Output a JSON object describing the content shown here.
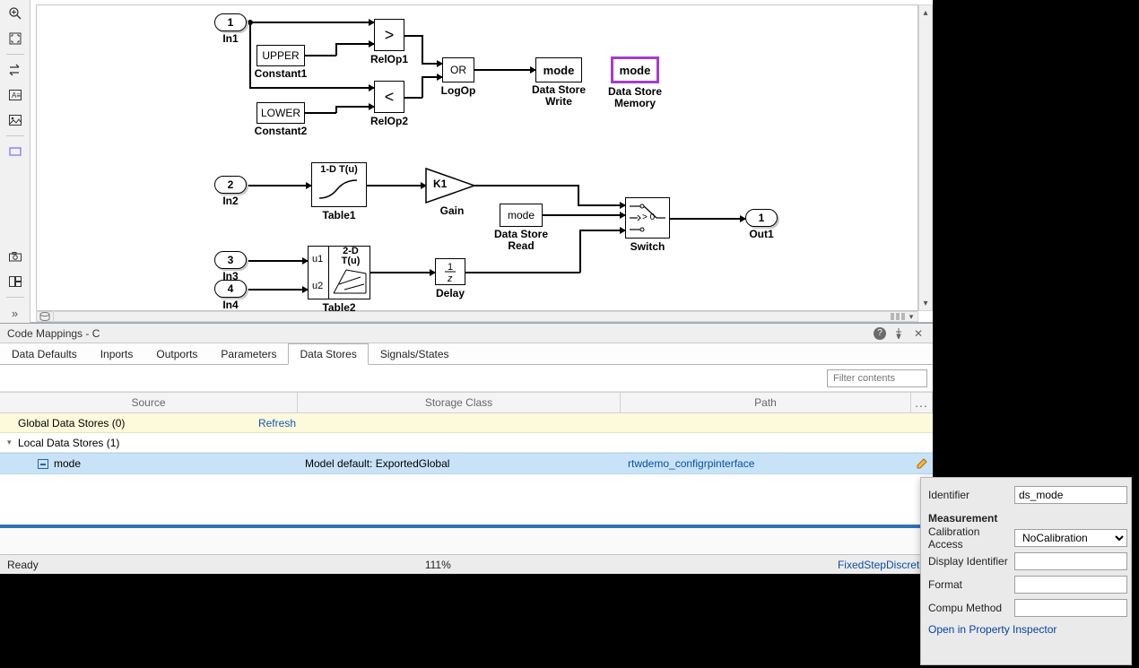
{
  "canvas": {
    "ports": {
      "in1": {
        "num": "1",
        "label": "In1"
      },
      "in2": {
        "num": "2",
        "label": "In2"
      },
      "in3": {
        "num": "3",
        "label": "In3"
      },
      "in4": {
        "num": "4",
        "label": "In4"
      },
      "out1": {
        "num": "1",
        "label": "Out1"
      }
    },
    "blocks": {
      "const1": {
        "text": "UPPER",
        "label": "Constant1"
      },
      "const2": {
        "text": "LOWER",
        "label": "Constant2"
      },
      "relop1": {
        "text": ">",
        "label": "RelOp1"
      },
      "relop2": {
        "text": "<",
        "label": "RelOp2"
      },
      "logop": {
        "text": "OR",
        "label": "LogOp"
      },
      "dswrite": {
        "text": "mode",
        "label": "Data Store\nWrite"
      },
      "dsmem": {
        "text": "mode",
        "label": "Data Store\nMemory"
      },
      "table1": {
        "text": "1-D T(u)",
        "label": "Table1"
      },
      "gain": {
        "text": "K1",
        "label": "Gain"
      },
      "dsread": {
        "text": "mode",
        "label": "Data Store\nRead"
      },
      "switch": {
        "text": "> 0",
        "label": "Switch"
      },
      "table2": {
        "header1": "u1",
        "header2": "u2",
        "text": "2-D\nT(u)",
        "label": "Table2"
      },
      "delay": {
        "text": "1/z",
        "label": "Delay"
      }
    }
  },
  "code_mappings": {
    "title": "Code Mappings - C",
    "tabs": [
      "Data Defaults",
      "Inports",
      "Outports",
      "Parameters",
      "Data Stores",
      "Signals/States"
    ],
    "active_tab": 4,
    "filter_placeholder": "Filter contents",
    "columns": {
      "source": "Source",
      "storage": "Storage Class",
      "path": "Path",
      "more": "..."
    },
    "global_section": "Global Data Stores (0)",
    "refresh": "Refresh",
    "local_section": "Local Data Stores (1)",
    "row": {
      "name": "mode",
      "storage": "Model default: ExportedGlobal",
      "path": "rtwdemo_configrpinterface"
    }
  },
  "status": {
    "ready": "Ready",
    "zoom": "111%",
    "solver": "FixedStepDiscrete"
  },
  "popup": {
    "identifier_label": "Identifier",
    "identifier_value": "ds_mode",
    "measurement_heading": "Measurement",
    "calib_label": "Calibration Access",
    "calib_value": "NoCalibration",
    "display_label": "Display Identifier",
    "format_label": "Format",
    "compu_label": "Compu Method",
    "open_link": "Open in Property Inspector"
  }
}
